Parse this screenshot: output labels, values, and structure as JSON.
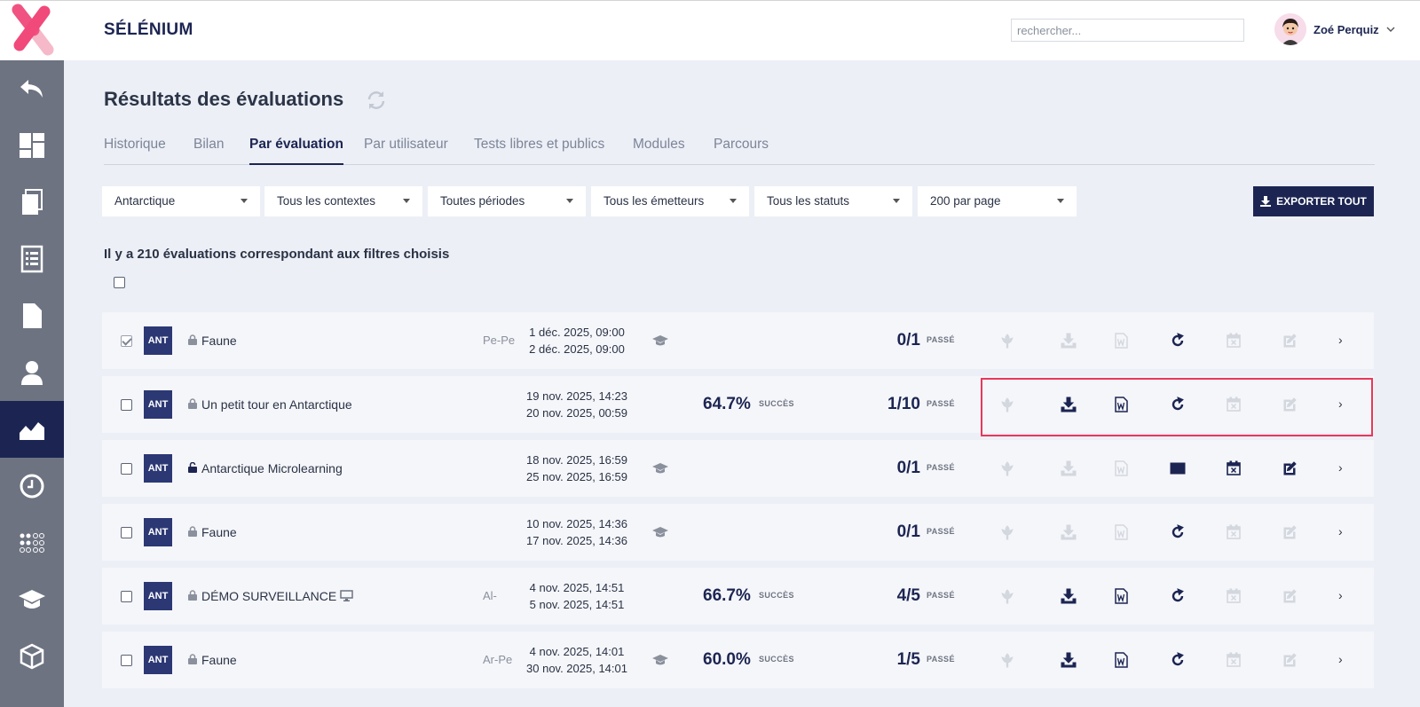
{
  "app": {
    "name": "SÉLÉNIUM"
  },
  "search": {
    "placeholder": "rechercher..."
  },
  "user": {
    "name": "Zoé Perquiz"
  },
  "sidebar": {
    "items": [
      {
        "icon": "back-arrow-icon"
      },
      {
        "icon": "dashboard-icon"
      },
      {
        "icon": "documents-icon"
      },
      {
        "icon": "list-icon"
      },
      {
        "icon": "file-icon"
      },
      {
        "icon": "user-icon"
      },
      {
        "icon": "chart-icon",
        "active": true
      },
      {
        "icon": "clock-icon"
      },
      {
        "icon": "dots-grid-icon"
      },
      {
        "icon": "graduation-cap-icon"
      },
      {
        "icon": "cube-icon"
      }
    ]
  },
  "page": {
    "title": "Résultats des évaluations"
  },
  "tabs": [
    {
      "label": "Historique"
    },
    {
      "label": "Bilan"
    },
    {
      "label": "Par évaluation",
      "active": true
    },
    {
      "label": "Par utilisateur"
    },
    {
      "label": "Tests libres et publics"
    },
    {
      "label": "Modules"
    },
    {
      "label": "Parcours"
    }
  ],
  "filters": [
    {
      "value": "Antarctique"
    },
    {
      "value": "Tous les contextes"
    },
    {
      "value": "Toutes périodes"
    },
    {
      "value": "Tous les émetteurs"
    },
    {
      "value": "Tous les statuts"
    },
    {
      "value": "200 par page"
    }
  ],
  "export": {
    "label": "EXPORTER TOUT"
  },
  "results": {
    "count_text": "Il y a 210 évaluations correspondant aux filtres choisis"
  },
  "rows": [
    {
      "badge": "ANT",
      "name": "Faune",
      "initials": "Pe-Pe",
      "start": "1 déc. 2025, 09:00",
      "end": "2 déc. 2025, 09:00",
      "pct": "",
      "pct_label": "",
      "score": "0/1",
      "status": "PASSÉ",
      "checked": true
    },
    {
      "badge": "ANT",
      "name": "Un petit tour en Antarctique",
      "initials": "",
      "start": "19 nov. 2025, 14:23",
      "end": "20 nov. 2025, 00:59",
      "pct": "64.7%",
      "pct_label": "SUCCÈS",
      "score": "1/10",
      "status": "PASSÉ"
    },
    {
      "badge": "ANT",
      "name": "Antarctique Microlearning",
      "initials": "",
      "start": "18 nov. 2025, 16:59",
      "end": "25 nov. 2025, 16:59",
      "pct": "",
      "pct_label": "",
      "score": "0/1",
      "status": "PASSÉ"
    },
    {
      "badge": "ANT",
      "name": "Faune",
      "initials": "",
      "start": "10 nov. 2025, 14:36",
      "end": "17 nov. 2025, 14:36",
      "pct": "",
      "pct_label": "",
      "score": "0/1",
      "status": "PASSÉ"
    },
    {
      "badge": "ANT",
      "name": "DÉMO SURVEILLANCE",
      "initials": "Al-",
      "start": "4 nov. 2025, 14:51",
      "end": "5 nov. 2025, 14:51",
      "pct": "66.7%",
      "pct_label": "SUCCÈS",
      "score": "4/5",
      "status": "PASSÉ"
    },
    {
      "badge": "ANT",
      "name": "Faune",
      "initials": "Ar-Pe",
      "start": "4 nov. 2025, 14:01",
      "end": "30 nov. 2025, 14:01",
      "pct": "60.0%",
      "pct_label": "SUCCÈS",
      "score": "1/5",
      "status": "PASSÉ"
    }
  ],
  "colors": {
    "brand": "#1c2552",
    "sidebar": "#6d7381",
    "highlight": "#e8385a",
    "logo_pink": "#f0497a"
  }
}
